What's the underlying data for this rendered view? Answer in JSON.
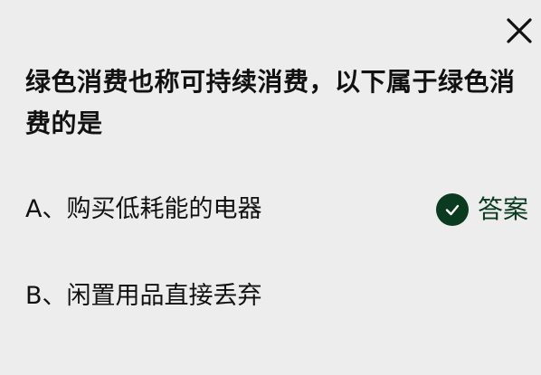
{
  "question": {
    "text": "绿色消费也称可持续消费，以下属于绿色消费的是"
  },
  "options": [
    {
      "label": "A、购买低耗能的电器",
      "is_answer": true
    },
    {
      "label": "B、闲置用品直接丢弃",
      "is_answer": false
    }
  ],
  "answer_tag": {
    "label": "答案",
    "icon": "check-circle-icon"
  },
  "close": {
    "icon": "close-icon"
  },
  "colors": {
    "background": "#ededed",
    "text": "#111111",
    "answer_accent": "#0a3a1f"
  }
}
